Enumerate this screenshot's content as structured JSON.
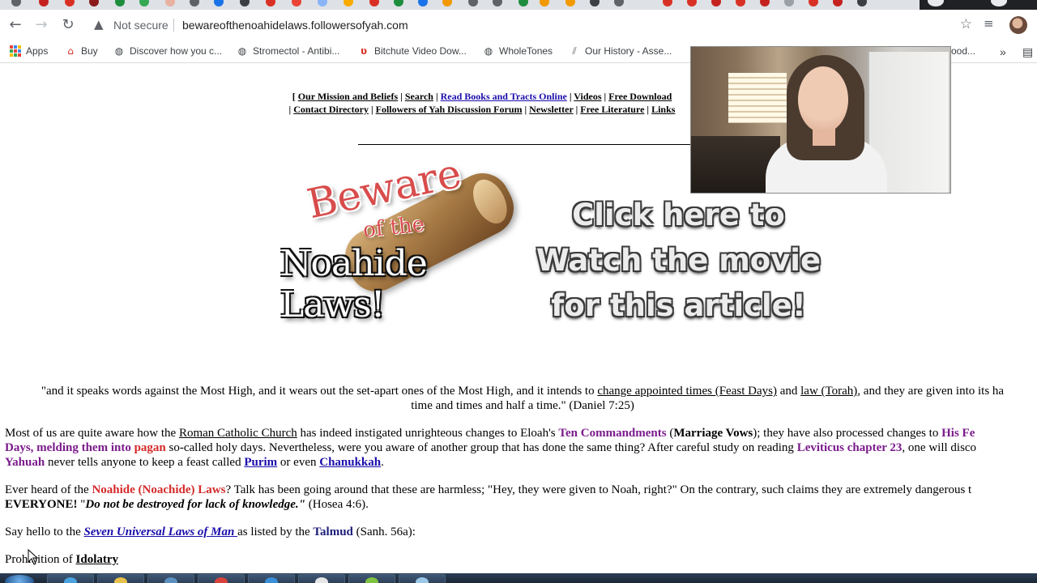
{
  "browser": {
    "security_label": "Not secure",
    "url": "bewareofthenoahidelaws.followersofyah.com",
    "bookmarks": [
      {
        "label": "Apps",
        "icon": "apps-grid-icon"
      },
      {
        "label": "Buy",
        "icon": "home-icon"
      },
      {
        "label": "Discover how you c...",
        "icon": "globe-icon"
      },
      {
        "label": "Stromectol - Antibi...",
        "icon": "globe-icon"
      },
      {
        "label": "Bitchute Video Dow...",
        "icon": "bitchute-icon"
      },
      {
        "label": "WholeTones",
        "icon": "globe-icon"
      },
      {
        "label": "Our History - Asse...",
        "icon": "bookmark-icon"
      },
      {
        "label": "ood...",
        "icon": ""
      }
    ],
    "overflow_label": "»"
  },
  "page": {
    "nav": {
      "row1": [
        "Our Mission and Beliefs",
        "Search",
        "Read Books and Tracts Online",
        "Videos",
        "Free Download"
      ],
      "row2": [
        "Contact Directory",
        "Followers of Yah Discussion Forum",
        "Newsletter",
        "Free Literature",
        "Links"
      ]
    },
    "logo": {
      "line1": "Beware",
      "line2": "of the",
      "line3": "Noahide Laws!"
    },
    "cta": {
      "line1": "Click here to",
      "line2": "Watch the movie",
      "line3": "for this article!"
    },
    "quote": {
      "p1": "\"and it speaks words against the Most High, and it wears out the set-apart ones of the Most High, and it intends to ",
      "link1": "change appointed times (Feast Days)",
      "p2": " and ",
      "link2": "law (Torah)",
      "p3": ", and they are given into its ha",
      "line2": "time and times and half a time.\" (Daniel 7:25)"
    },
    "para1": {
      "a": "Most of us are quite aware how the ",
      "rcc": "Roman Catholic Church",
      "b": " has indeed instigated unrighteous changes to Eloah's ",
      "tc": "Ten Commandments",
      "c": " (",
      "mv": "Marriage Vows",
      "d": "); they have also processed changes to ",
      "hf": "His Fe",
      "l2a": "Days, melding them into ",
      "pagan": "pagan",
      "l2b": " so-called holy days. Nevertheless, were you aware of another group that has done the same thing? After careful study on reading ",
      "lev": "Leviticus chapter 23",
      "l2c": ", one will disco",
      "yah": "Yahuah",
      "l3a": " never tells anyone to keep a feast called ",
      "purim": "Purim",
      "l3b": " or even ",
      "chan": "Chanukkah",
      "l3c": "."
    },
    "para2": {
      "a": "Ever heard of the ",
      "nl": "Noahide (Noachide) Laws",
      "b": "? Talk has been going around that these are harmless; \"Hey, they were given to Noah, right?\" On the contrary, such claims they are extremely dangerous t",
      "every": "EVERYONE!",
      "c": " \"",
      "dnb": "Do not be destroyed for lack of knowledge.\"",
      "d": " (Hosea 4:6)."
    },
    "para3": {
      "a": "Say hello to the ",
      "sul": "Seven Universal Laws of Man ",
      "b": "as listed by the ",
      "talmud": "Talmud",
      "c": " (Sanh. 56a):"
    },
    "para4": {
      "a": "Prohibition of ",
      "idol": "Idolatry"
    }
  },
  "colors": {
    "purple": "#7b1b8c",
    "red": "#d42a2a",
    "link": "#1a0dab",
    "navy": "#1d1d7a"
  }
}
